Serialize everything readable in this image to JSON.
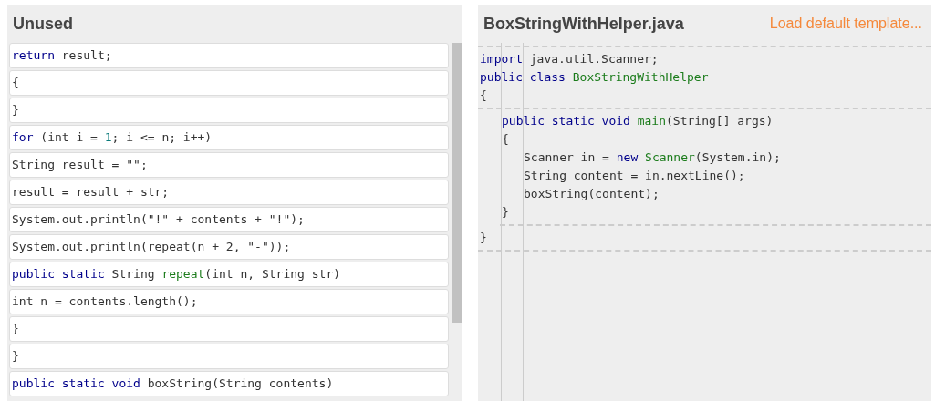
{
  "unused": {
    "title": "Unused",
    "tiles": [
      [
        {
          "text": "return",
          "kind": "keyword"
        },
        {
          "text": " result;",
          "kind": "plain"
        }
      ],
      [
        {
          "text": "{",
          "kind": "plain"
        }
      ],
      [
        {
          "text": "}",
          "kind": "plain"
        }
      ],
      [
        {
          "text": "for",
          "kind": "keyword"
        },
        {
          "text": " (int i = ",
          "kind": "plain"
        },
        {
          "text": "1",
          "kind": "number"
        },
        {
          "text": "; i <= n; i++)",
          "kind": "plain"
        }
      ],
      [
        {
          "text": "String result = \"\";",
          "kind": "plain"
        }
      ],
      [
        {
          "text": "result = result + str;",
          "kind": "plain"
        }
      ],
      [
        {
          "text": "System.out.println(\"!\" + contents + \"!\");",
          "kind": "plain"
        }
      ],
      [
        {
          "text": "System.out.println(repeat(n + 2, \"-\"));",
          "kind": "plain"
        }
      ],
      [
        {
          "text": "public static",
          "kind": "keyword"
        },
        {
          "text": " String ",
          "kind": "plain"
        },
        {
          "text": "repeat",
          "kind": "name"
        },
        {
          "text": "(int n, String str)",
          "kind": "plain"
        }
      ],
      [
        {
          "text": "int n = contents.length();",
          "kind": "plain"
        }
      ],
      [
        {
          "text": "}",
          "kind": "plain"
        }
      ],
      [
        {
          "text": "}",
          "kind": "plain"
        }
      ],
      [
        {
          "text": "public static void",
          "kind": "keyword"
        },
        {
          "text": " boxString(String contents)",
          "kind": "plain"
        }
      ]
    ]
  },
  "editor": {
    "title": "BoxStringWithHelper.java",
    "template_link": "Load default template...",
    "items": [
      {
        "kind": "divider"
      },
      {
        "kind": "code",
        "tokens": [
          {
            "text": "import",
            "kind": "keyword"
          },
          {
            "text": " java.util.Scanner;",
            "kind": "plain"
          }
        ]
      },
      {
        "kind": "code",
        "tokens": [
          {
            "text": "public class ",
            "kind": "keyword"
          },
          {
            "text": "BoxStringWithHelper",
            "kind": "name"
          }
        ]
      },
      {
        "kind": "code",
        "tokens": [
          {
            "text": "{",
            "kind": "plain"
          }
        ]
      },
      {
        "kind": "divider"
      },
      {
        "kind": "block",
        "children": [
          {
            "kind": "code",
            "tokens": [
              {
                "text": "public static void ",
                "kind": "keyword"
              },
              {
                "text": "main",
                "kind": "name"
              },
              {
                "text": "(String[] args)",
                "kind": "plain"
              }
            ]
          },
          {
            "kind": "code",
            "tokens": [
              {
                "text": "{",
                "kind": "plain"
              }
            ]
          },
          {
            "kind": "block",
            "children": [
              {
                "kind": "code",
                "tokens": [
                  {
                    "text": "Scanner in = ",
                    "kind": "plain"
                  },
                  {
                    "text": "new ",
                    "kind": "keyword"
                  },
                  {
                    "text": "Scanner",
                    "kind": "name"
                  },
                  {
                    "text": "(System.in);",
                    "kind": "plain"
                  }
                ]
              },
              {
                "kind": "code",
                "tokens": [
                  {
                    "text": "String content = in.nextLine();",
                    "kind": "plain"
                  }
                ]
              },
              {
                "kind": "code",
                "tokens": [
                  {
                    "text": "boxString(content);",
                    "kind": "plain"
                  }
                ]
              }
            ]
          },
          {
            "kind": "code",
            "tokens": [
              {
                "text": "}",
                "kind": "plain"
              }
            ]
          },
          {
            "kind": "divider"
          }
        ]
      },
      {
        "kind": "code",
        "tokens": [
          {
            "text": "}",
            "kind": "plain"
          }
        ]
      },
      {
        "kind": "divider"
      }
    ]
  }
}
